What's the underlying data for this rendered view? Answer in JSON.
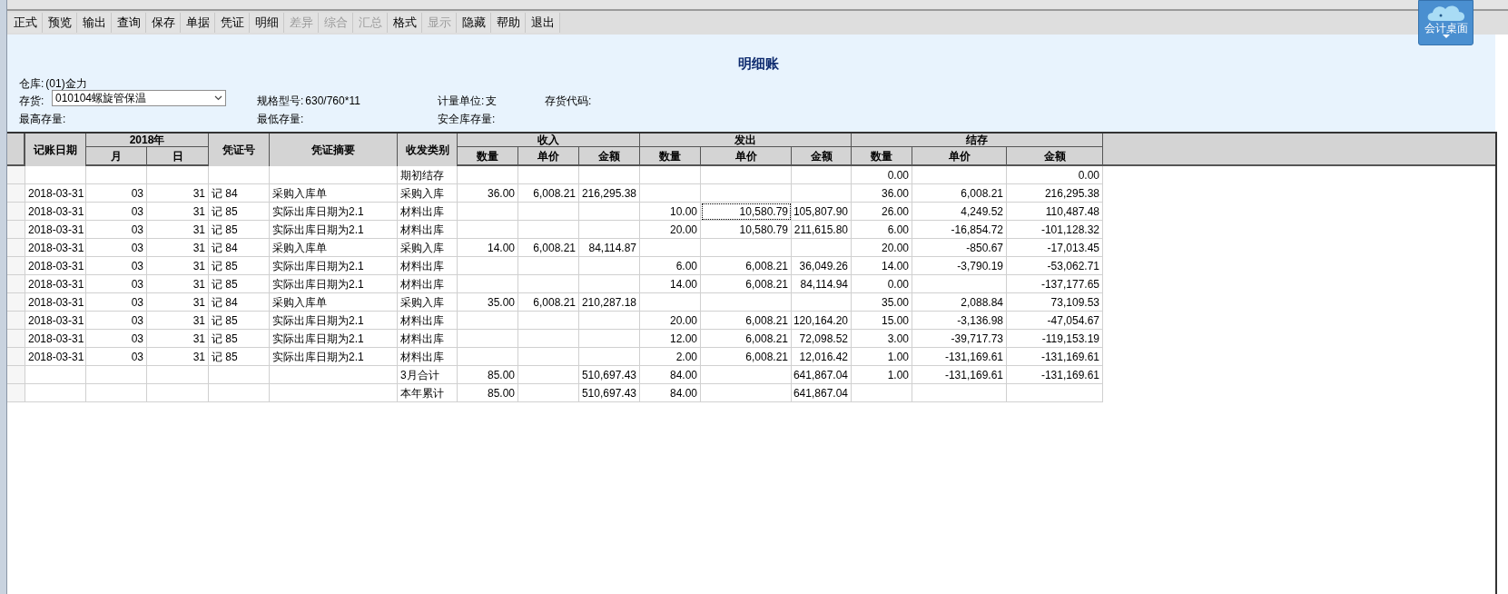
{
  "toolbar": [
    {
      "label": "正式",
      "disabled": false
    },
    {
      "label": "预览",
      "disabled": false
    },
    {
      "label": "输出",
      "disabled": false
    },
    {
      "label": "查询",
      "disabled": false
    },
    {
      "label": "保存",
      "disabled": false
    },
    {
      "label": "单据",
      "disabled": false
    },
    {
      "label": "凭证",
      "disabled": false
    },
    {
      "label": "明细",
      "disabled": false
    },
    {
      "label": "差异",
      "disabled": true
    },
    {
      "label": "综合",
      "disabled": true
    },
    {
      "label": "汇总",
      "disabled": true
    },
    {
      "label": "格式",
      "disabled": false
    },
    {
      "label": "显示",
      "disabled": true
    },
    {
      "label": "隐藏",
      "disabled": false
    },
    {
      "label": "帮助",
      "disabled": false
    },
    {
      "label": "退出",
      "disabled": false
    }
  ],
  "desktop_badge": {
    "label": "会计桌面"
  },
  "report": {
    "title": "明细账",
    "warehouse": {
      "label": "仓库:",
      "value": "(01)金力"
    },
    "inventory": {
      "label": "存货:",
      "value": "010104螺旋管保温"
    },
    "spec": {
      "label": "规格型号:",
      "value": "630/760*11"
    },
    "unit": {
      "label": "计量单位:",
      "value": "支"
    },
    "code": {
      "label": "存货代码:"
    },
    "max_stock": {
      "label": "最高存量:"
    },
    "min_stock": {
      "label": "最低存量:"
    },
    "safety_stock": {
      "label": "安全库存量:"
    }
  },
  "table": {
    "header": {
      "date": "记账日期",
      "year": "2018年",
      "month": "月",
      "day": "日",
      "voucher": "凭证号",
      "summary": "凭证摘要",
      "type": "收发类别",
      "receipt": {
        "label": "收入",
        "columns": [
          "数量",
          "单价",
          "金额"
        ]
      },
      "issue": {
        "label": "发出",
        "columns": [
          "数量",
          "单价",
          "金额"
        ]
      },
      "balance": {
        "label": "结存",
        "columns": [
          "数量",
          "单价",
          "金额"
        ]
      }
    },
    "rows": [
      {
        "type": "期初结存",
        "bal_qty": "0.00",
        "bal_amount": "0.00"
      },
      {
        "date": "2018-03-31",
        "month": "03",
        "day": "31",
        "voucher": "记 84",
        "summary": "采购入库单",
        "type": "采购入库",
        "in_qty": "36.00",
        "in_price": "6,008.21",
        "in_amount": "216,295.38",
        "bal_qty": "36.00",
        "bal_price": "6,008.21",
        "bal_amount": "216,295.38"
      },
      {
        "date": "2018-03-31",
        "month": "03",
        "day": "31",
        "voucher": "记 85",
        "summary": "实际出库日期为2.1",
        "type": "材料出库",
        "out_qty": "10.00",
        "out_price": "10,580.79",
        "out_amount": "105,807.90",
        "bal_qty": "26.00",
        "bal_price": "4,249.52",
        "bal_amount": "110,487.48",
        "focused": true
      },
      {
        "date": "2018-03-31",
        "month": "03",
        "day": "31",
        "voucher": "记 85",
        "summary": "实际出库日期为2.1",
        "type": "材料出库",
        "out_qty": "20.00",
        "out_price": "10,580.79",
        "out_amount": "211,615.80",
        "bal_qty": "6.00",
        "bal_price": "-16,854.72",
        "bal_amount": "-101,128.32"
      },
      {
        "date": "2018-03-31",
        "month": "03",
        "day": "31",
        "voucher": "记 84",
        "summary": "采购入库单",
        "type": "采购入库",
        "in_qty": "14.00",
        "in_price": "6,008.21",
        "in_amount": "84,114.87",
        "bal_qty": "20.00",
        "bal_price": "-850.67",
        "bal_amount": "-17,013.45"
      },
      {
        "date": "2018-03-31",
        "month": "03",
        "day": "31",
        "voucher": "记 85",
        "summary": "实际出库日期为2.1",
        "type": "材料出库",
        "out_qty": "6.00",
        "out_price": "6,008.21",
        "out_amount": "36,049.26",
        "bal_qty": "14.00",
        "bal_price": "-3,790.19",
        "bal_amount": "-53,062.71"
      },
      {
        "date": "2018-03-31",
        "month": "03",
        "day": "31",
        "voucher": "记 85",
        "summary": "实际出库日期为2.1",
        "type": "材料出库",
        "out_qty": "14.00",
        "out_price": "6,008.21",
        "out_amount": "84,114.94",
        "bal_qty": "0.00",
        "bal_amount": "-137,177.65"
      },
      {
        "date": "2018-03-31",
        "month": "03",
        "day": "31",
        "voucher": "记 84",
        "summary": "采购入库单",
        "type": "采购入库",
        "in_qty": "35.00",
        "in_price": "6,008.21",
        "in_amount": "210,287.18",
        "bal_qty": "35.00",
        "bal_price": "2,088.84",
        "bal_amount": "73,109.53"
      },
      {
        "date": "2018-03-31",
        "month": "03",
        "day": "31",
        "voucher": "记 85",
        "summary": "实际出库日期为2.1",
        "type": "材料出库",
        "out_qty": "20.00",
        "out_price": "6,008.21",
        "out_amount": "120,164.20",
        "bal_qty": "15.00",
        "bal_price": "-3,136.98",
        "bal_amount": "-47,054.67"
      },
      {
        "date": "2018-03-31",
        "month": "03",
        "day": "31",
        "voucher": "记 85",
        "summary": "实际出库日期为2.1",
        "type": "材料出库",
        "out_qty": "12.00",
        "out_price": "6,008.21",
        "out_amount": "72,098.52",
        "bal_qty": "3.00",
        "bal_price": "-39,717.73",
        "bal_amount": "-119,153.19"
      },
      {
        "date": "2018-03-31",
        "month": "03",
        "day": "31",
        "voucher": "记 85",
        "summary": "实际出库日期为2.1",
        "type": "材料出库",
        "out_qty": "2.00",
        "out_price": "6,008.21",
        "out_amount": "12,016.42",
        "bal_qty": "1.00",
        "bal_price": "-131,169.61",
        "bal_amount": "-131,169.61"
      },
      {
        "type": "3月合计",
        "in_qty": "85.00",
        "in_amount": "510,697.43",
        "out_qty": "84.00",
        "out_amount": "641,867.04",
        "bal_qty": "1.00",
        "bal_price": "-131,169.61",
        "bal_amount": "-131,169.61"
      },
      {
        "type": "本年累计",
        "in_qty": "85.00",
        "in_amount": "510,697.43",
        "out_qty": "84.00",
        "out_amount": "641,867.04"
      }
    ]
  }
}
